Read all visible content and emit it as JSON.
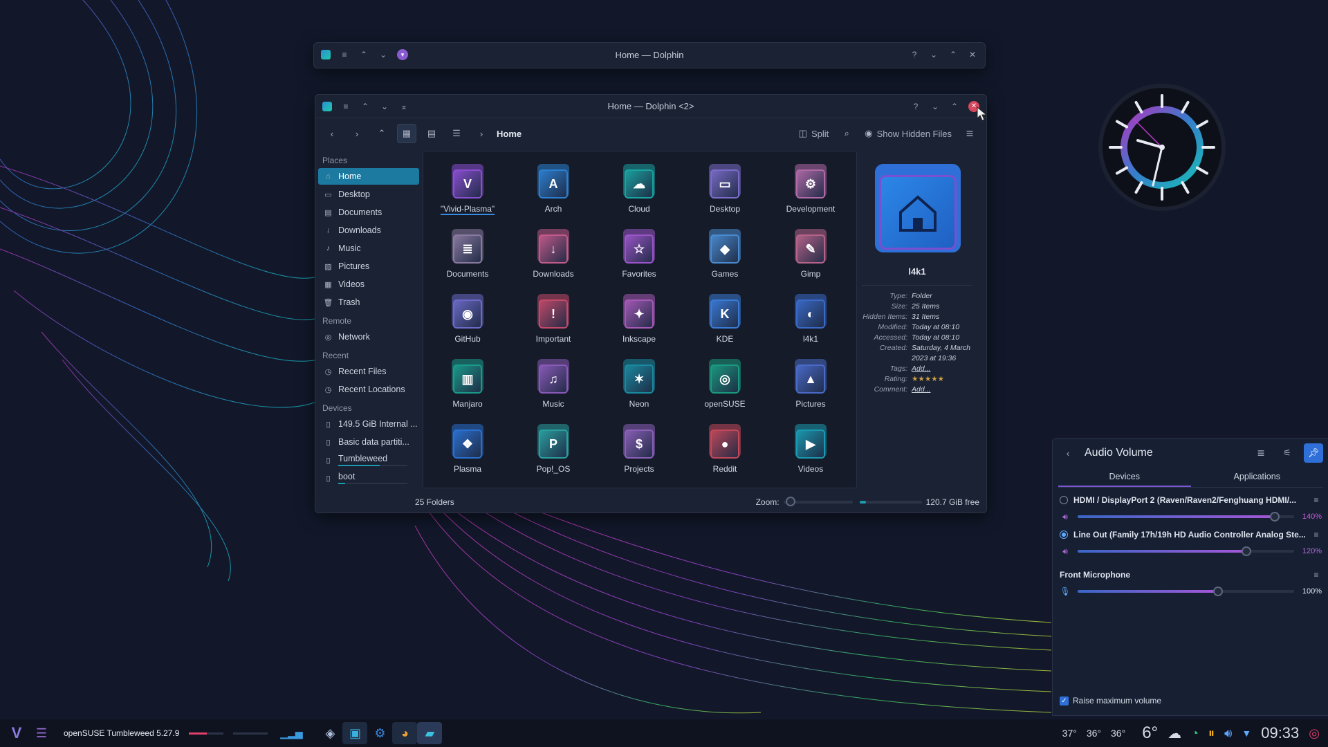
{
  "window_back": {
    "title": "Home — Dolphin"
  },
  "window_front": {
    "title": "Home — Dolphin <2>",
    "breadcrumb": "Home",
    "split_label": "Split",
    "hidden_label": "Show Hidden Files",
    "status_left": "25 Folders",
    "zoom_label": "Zoom:",
    "zoom_level": 0.1,
    "free_fill": 0.1,
    "free_space": "120.7 GiB free"
  },
  "sidebar": {
    "places_title": "Places",
    "places": [
      {
        "label": "Home",
        "icon": "home-icon"
      },
      {
        "label": "Desktop",
        "icon": "desktop-icon"
      },
      {
        "label": "Documents",
        "icon": "documents-icon"
      },
      {
        "label": "Downloads",
        "icon": "download-icon"
      },
      {
        "label": "Music",
        "icon": "music-icon"
      },
      {
        "label": "Pictures",
        "icon": "picture-icon"
      },
      {
        "label": "Videos",
        "icon": "video-icon"
      },
      {
        "label": "Trash",
        "icon": "trash-icon"
      }
    ],
    "remote_title": "Remote",
    "remote": [
      {
        "label": "Network",
        "icon": "network-icon"
      }
    ],
    "recent_title": "Recent",
    "recent": [
      {
        "label": "Recent Files",
        "icon": "recent-files-icon"
      },
      {
        "label": "Recent Locations",
        "icon": "recent-locations-icon"
      }
    ],
    "devices_title": "Devices",
    "devices": [
      {
        "label": "149.5 GiB Internal ...",
        "icon": "drive-icon",
        "usage": 0
      },
      {
        "label": "Basic data partiti...",
        "icon": "drive-icon",
        "usage": 0
      },
      {
        "label": "Tumbleweed",
        "icon": "drive-icon",
        "usage": 0.6
      },
      {
        "label": "boot",
        "icon": "drive-icon",
        "usage": 0.1
      }
    ]
  },
  "folders": [
    {
      "label": "\"Vivid-Plasma\"",
      "glyph": "V",
      "color": "#8a4fd1"
    },
    {
      "label": "Arch",
      "glyph": "A",
      "color": "#2c7fd0"
    },
    {
      "label": "Cloud",
      "glyph": "☁",
      "color": "#1aa3a0"
    },
    {
      "label": "Desktop",
      "glyph": "▭",
      "color": "#7a6cc8"
    },
    {
      "label": "Development",
      "glyph": "⚙",
      "color": "#b06aa8"
    },
    {
      "label": "Documents",
      "glyph": "≣",
      "color": "#8a7aa0"
    },
    {
      "label": "Downloads",
      "glyph": "↓",
      "color": "#c25a8a"
    },
    {
      "label": "Favorites",
      "glyph": "☆",
      "color": "#9b55c9"
    },
    {
      "label": "Games",
      "glyph": "◆",
      "color": "#4a8ad0"
    },
    {
      "label": "Gimp",
      "glyph": "✎",
      "color": "#b6638a"
    },
    {
      "label": "GitHub",
      "glyph": "◉",
      "color": "#6c6ac8"
    },
    {
      "label": "Important",
      "glyph": "!",
      "color": "#c24a6a"
    },
    {
      "label": "Inkscape",
      "glyph": "✦",
      "color": "#a65ab8"
    },
    {
      "label": "KDE",
      "glyph": "K",
      "color": "#3a7ad6"
    },
    {
      "label": "l4k1",
      "glyph": "◐",
      "color": "#3a6ac8"
    },
    {
      "label": "Manjaro",
      "glyph": "▥",
      "color": "#1a9a8a"
    },
    {
      "label": "Music",
      "glyph": "♫",
      "color": "#8a5ab8"
    },
    {
      "label": "Neon",
      "glyph": "✶",
      "color": "#1a8aa0"
    },
    {
      "label": "openSUSE",
      "glyph": "◎",
      "color": "#1a9a80"
    },
    {
      "label": "Pictures",
      "glyph": "▲",
      "color": "#4a6ac8"
    },
    {
      "label": "Plasma",
      "glyph": "❖",
      "color": "#2a70d0"
    },
    {
      "label": "Pop!_OS",
      "glyph": "P",
      "color": "#2aa0a0"
    },
    {
      "label": "Projects",
      "glyph": "$",
      "color": "#8a60b8"
    },
    {
      "label": "Reddit",
      "glyph": "●",
      "color": "#c2485a"
    },
    {
      "label": "Videos",
      "glyph": "▶",
      "color": "#1a9ab0"
    }
  ],
  "info": {
    "name": "l4k1",
    "type_k": "Type:",
    "type_v": "Folder",
    "size_k": "Size:",
    "size_v": "25 Items",
    "hidden_k": "Hidden Items:",
    "hidden_v": "31 Items",
    "modified_k": "Modified:",
    "modified_v": "Today at 08:10",
    "accessed_k": "Accessed:",
    "accessed_v": "Today at 08:10",
    "created_k": "Created:",
    "created_v": "Saturday, 4 March 2023 at 19:36",
    "tags_k": "Tags:",
    "tags_v": "Add...",
    "rating_k": "Rating:",
    "rating_v": "★★★★★",
    "comment_k": "Comment:",
    "comment_v": "Add..."
  },
  "audio": {
    "title": "Audio Volume",
    "tab_devices": "Devices",
    "tab_applications": "Applications",
    "devices": [
      {
        "name": "HDMI / DisplayPort 2 (Raven/Raven2/Fenghuang HDMI/...",
        "volume": "140%",
        "level": 0.91,
        "selected": false,
        "pct_color": "#c45ad8"
      },
      {
        "name": "Line Out (Family 17h/19h HD Audio Controller Analog Ste...",
        "volume": "120%",
        "level": 0.78,
        "selected": true,
        "pct_color": "#b06ad8"
      }
    ],
    "mic": {
      "name": "Front Microphone",
      "volume": "100%",
      "level": 0.65
    },
    "raise_label": "Raise maximum volume"
  },
  "taskbar": {
    "distro_label": "openSUSE Tumbleweed 5.27.9",
    "temps": [
      "37°",
      "36°",
      "36°"
    ],
    "weather_temp": "6°",
    "clock": "09:33"
  },
  "colors": {
    "accent": "#1c7aa0",
    "highlight": "#7a57d1"
  }
}
